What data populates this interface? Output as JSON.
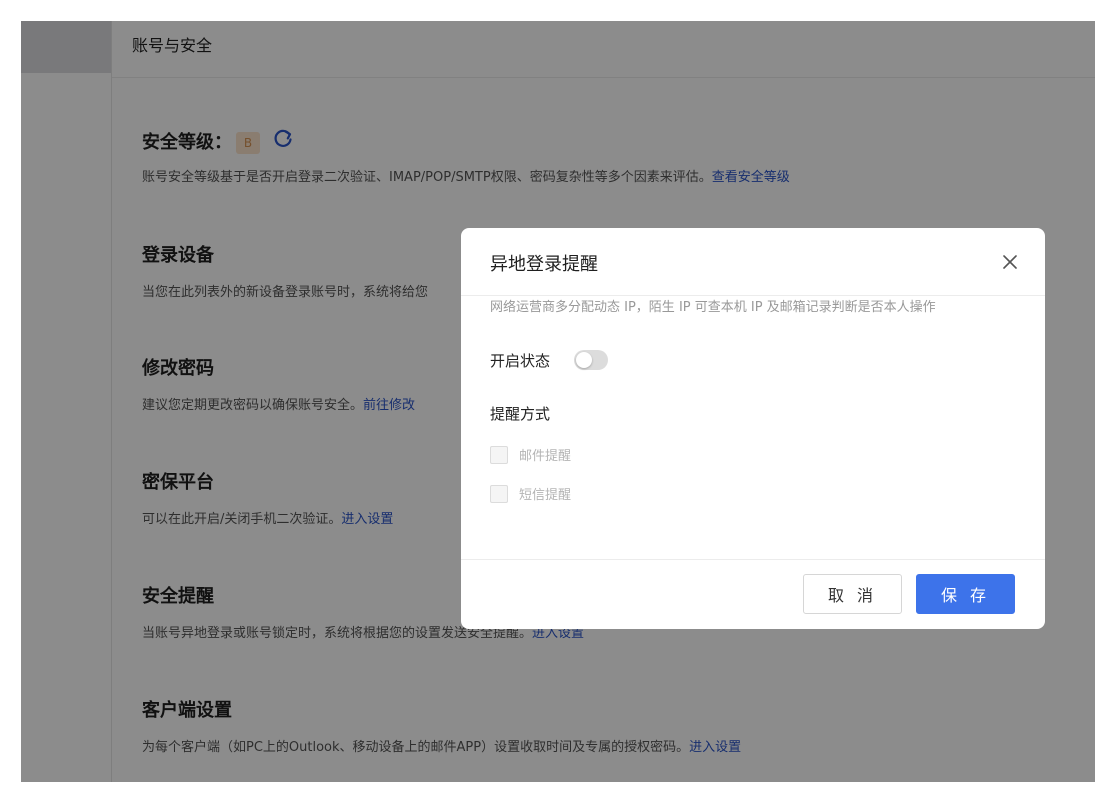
{
  "page": {
    "title": "账号与安全"
  },
  "sections": {
    "level": {
      "title": "安全等级：",
      "badge": "B",
      "desc": "账号安全等级基于是否开启登录二次验证、IMAP/POP/SMTP权限、密码复杂性等多个因素来评估。",
      "link": "查看安全等级"
    },
    "devices": {
      "title": "登录设备",
      "desc": "当您在此列表外的新设备登录账号时，系统将给您"
    },
    "password": {
      "title": "修改密码",
      "desc": "建议您定期更改密码以确保账号安全。",
      "link": "前往修改"
    },
    "secret": {
      "title": "密保平台",
      "desc": "可以在此开启/关闭手机二次验证。",
      "link": "进入设置"
    },
    "alert": {
      "title": "安全提醒",
      "desc": "当账号异地登录或账号锁定时，系统将根据您的设置发送安全提醒。",
      "link": "进入设置"
    },
    "client": {
      "title": "客户端设置",
      "desc": "为每个客户端（如PC上的Outlook、移动设备上的邮件APP）设置收取时间及专属的授权密码。",
      "link": "进入设置"
    }
  },
  "modal": {
    "title": "异地登录提醒",
    "note": "网络运营商多分配动态 IP，陌生 IP 可查本机 IP 及邮箱记录判断是否本人操作",
    "status_label": "开启状态",
    "toggle_on": false,
    "method_title": "提醒方式",
    "options": [
      {
        "label": "邮件提醒",
        "checked": false
      },
      {
        "label": "短信提醒",
        "checked": false
      }
    ],
    "cancel_label": "取 消",
    "save_label": "保 存"
  },
  "colors": {
    "primary": "#3d73ea",
    "link": "#2b55c9",
    "badge_bg": "#fbe4cc",
    "badge_text": "#d69352"
  }
}
